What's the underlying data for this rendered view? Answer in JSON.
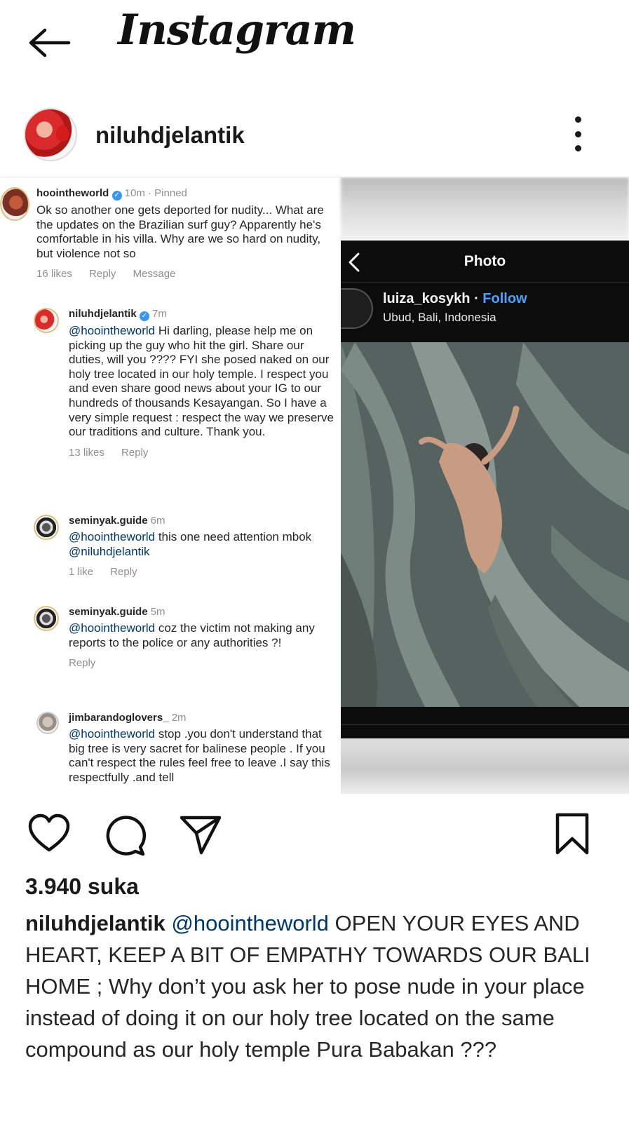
{
  "app": {
    "logo_text": "Instagram"
  },
  "post": {
    "username": "niluhdjelantik",
    "likes_label": "3.940 suka",
    "caption": {
      "username": "niluhdjelantik",
      "mention": "@hoointheworld",
      "text": " OPEN YOUR EYES AND HEART, KEEP A BIT OF EMPATHY TOWARDS OUR BALI HOME ; Why don’t you ask her to pose nude in your place instead of doing it on our holy tree located on the same compound as our holy temple Pura Babakan ???"
    }
  },
  "comments": [
    {
      "username": "hoointheworld",
      "verified": true,
      "meta": "10m · Pinned",
      "mention": "",
      "text": "Ok so another one gets deported for nudity... What are the updates on the Brazilian surf guy? Apparently he's comfortable in his villa. Why are we so hard on nudity, but violence not so",
      "likes": "16 likes",
      "reply": "Reply",
      "message": "Message"
    },
    {
      "username": "niluhdjelantik",
      "verified": true,
      "meta": "7m",
      "mention": "@hoointheworld",
      "text": " Hi darling, please help me on picking up the guy who hit the girl. Share our duties, will you ???? FYI she posed naked on our holy tree located in our holy temple. I respect you and even share good news about your IG to our hundreds of thousands Kesayangan. So I have a very simple request : respect the way we preserve our traditions and culture. Thank you.",
      "likes": "13 likes",
      "reply": "Reply"
    },
    {
      "username": "seminyak.guide",
      "verified": false,
      "meta": "6m",
      "mention": "@hoointheworld",
      "text": " this one need attention mbok ",
      "mention2": "@niluhdjelantik",
      "likes": "1 like",
      "reply": "Reply"
    },
    {
      "username": "seminyak.guide",
      "verified": false,
      "meta": "5m",
      "mention": "@hoointheworld",
      "text": " coz the victim not making any reports to the police or any authorities ?!",
      "reply": "Reply"
    },
    {
      "username": "jimbarandoglovers_",
      "verified": false,
      "meta": "2m",
      "mention": "@hoointheworld",
      "text": " stop .you don't understand that big tree is very sacret for balinese people . If you can't respect the rules feel free to leave .I say this respectfully .and tell"
    }
  ],
  "photo_panel": {
    "title": "Photo",
    "username": "luiza_kosykh",
    "separator": " · ",
    "follow": "Follow",
    "location": "Ubud, Bali, Indonesia"
  },
  "icons": {
    "back": "back-arrow-icon",
    "more": "more-options-icon",
    "like": "heart-icon",
    "comment": "comment-icon",
    "share": "send-icon",
    "save": "bookmark-icon"
  },
  "colors": {
    "mention": "#00376b",
    "follow": "#4aa3ff",
    "verified": "#3897f0",
    "meta_gray": "#8e8e8e"
  }
}
